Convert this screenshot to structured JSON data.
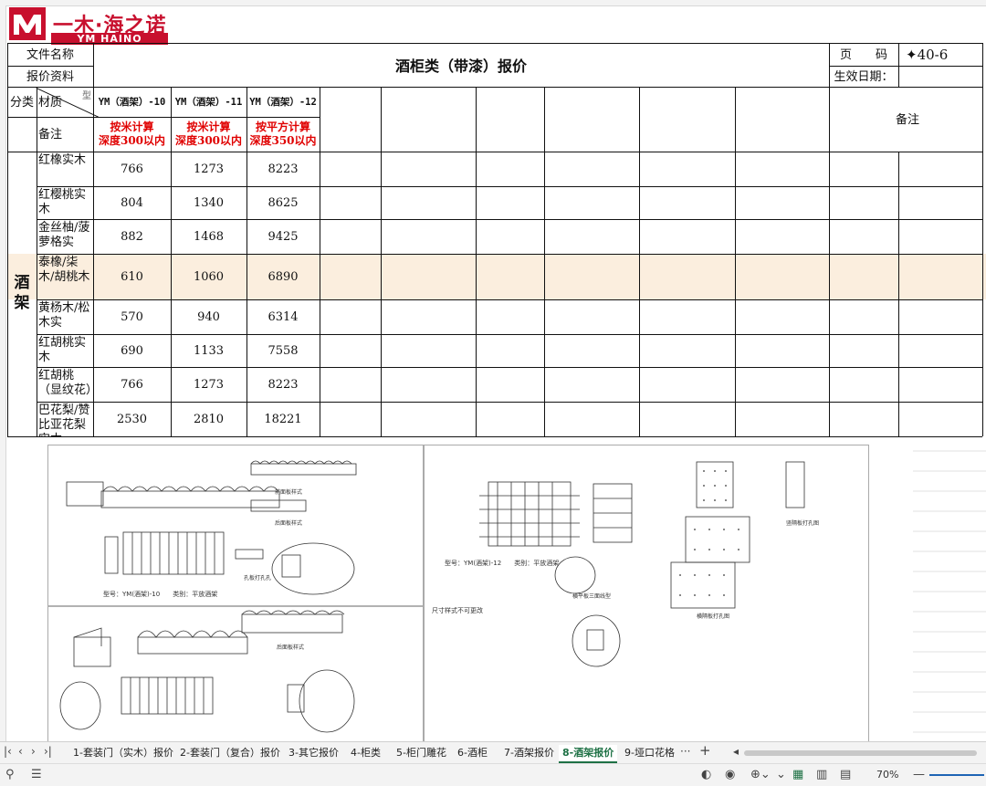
{
  "logo": {
    "text_top": "一木·海之诺",
    "text_bottom": "YM HAINO"
  },
  "header": {
    "file_name_label": "文件名称",
    "quote_data_label": "报价资料",
    "title": "酒柜类（带漆）报价",
    "page_label": "页　　码",
    "page_value": "✦40-6",
    "effective_date_label": "生效日期：",
    "category_label": "分类",
    "material_label": "材质",
    "material_suffix": "型",
    "remarks_label": "备注",
    "remarks_right": "备注"
  },
  "columns": [
    {
      "code": "YM（酒架）-10",
      "pricing": "按米计算",
      "depth": "深度300以内"
    },
    {
      "code": "YM（酒架）-11",
      "pricing": "按米计算",
      "depth": "深度300以内"
    },
    {
      "code": "YM（酒架）-12",
      "pricing": "按平方计算",
      "depth": "深度350以内"
    }
  ],
  "category_name": "酒\n架",
  "rows": [
    {
      "material": "红橡实木",
      "v1": "766",
      "v2": "1273",
      "v3": "8223"
    },
    {
      "material": "红樱桃实木",
      "v1": "804",
      "v2": "1340",
      "v3": "8625"
    },
    {
      "material": "金丝柚/菠萝格实",
      "v1": "882",
      "v2": "1468",
      "v3": "9425"
    },
    {
      "material": "泰橡/柒木/胡桃木",
      "v1": "610",
      "v2": "1060",
      "v3": "6890"
    },
    {
      "material": "黄杨木/松木实",
      "v1": "570",
      "v2": "940",
      "v3": "6314"
    },
    {
      "material": "红胡桃实木",
      "v1": "690",
      "v2": "1133",
      "v3": "7558"
    },
    {
      "material": "红胡桃（显纹花）",
      "v1": "766",
      "v2": "1273",
      "v3": "8223"
    },
    {
      "material": "巴花梨/赞比亚花梨实木",
      "v1": "2530",
      "v2": "2810",
      "v3": "18221"
    }
  ],
  "drawings": {
    "left_model_1": "型号：YM(酒架)-10　　类别：平放酒架",
    "left_label_front": "前面板样式",
    "left_label_back": "后面板样式",
    "left_label_hole": "孔板打孔孔",
    "left_label_top": "后面板样式",
    "right_model": "型号：YM(酒架)-12　　类别：平放酒架",
    "right_note": "尺寸样式不可更改",
    "right_label_1": "横平板三面线型",
    "right_label_2": "竖隔板打孔图",
    "right_label_3": "横隔板打孔图"
  },
  "tabs": {
    "items": [
      "1-套装门（实木）报价",
      "2-套装门（复合）报价",
      "3-其它报价",
      "4-柜类",
      "5-柜门雕花",
      "6-酒柜",
      "7-酒架报价",
      "8-酒架报价",
      "9-垭口花格"
    ],
    "active_index": 7,
    "more": "···",
    "add": "+"
  },
  "status": {
    "zoom": "70%"
  }
}
